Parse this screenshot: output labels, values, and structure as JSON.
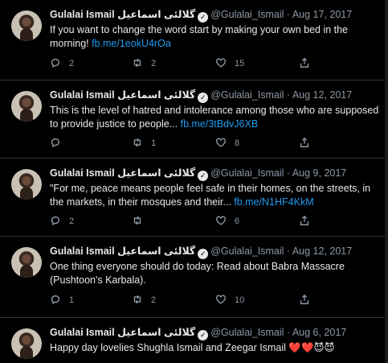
{
  "tweets": [
    {
      "name": "Gulalai Ismail گلالئی اسماعیل",
      "handle": "@Gulalai_Ismail",
      "date": "Aug 17, 2017",
      "text": "If you  want to change the word start by making your own bed in the morning! ",
      "link": "fb.me/1eokU4rOa",
      "replies": "2",
      "retweets": "2",
      "likes": "15"
    },
    {
      "name": "Gulalai Ismail گلالئی اسماعیل",
      "handle": "@Gulalai_Ismail",
      "date": "Aug 12, 2017",
      "text": "This is the level of hatred and intolerance among those who are supposed to provide justice to people... ",
      "link": "fb.me/3tBdvJ6XB",
      "replies": "",
      "retweets": "1",
      "likes": "8"
    },
    {
      "name": "Gulalai Ismail گلالئی اسماعیل",
      "handle": "@Gulalai_Ismail",
      "date": "Aug 9, 2017",
      "text": "\"For me, peace means people feel safe in their homes, on the streets, in the markets, in their mosques and their... ",
      "link": "fb.me/N1HF4KkM",
      "replies": "2",
      "retweets": "",
      "likes": "6"
    },
    {
      "name": "Gulalai Ismail گلالئی اسماعیل",
      "handle": "@Gulalai_Ismail",
      "date": "Aug 12, 2017",
      "text": "One thing everyone should do today: Read about Babra Massacre (Pushtoon's Karbala).",
      "link": "",
      "replies": "1",
      "retweets": "2",
      "likes": "10"
    },
    {
      "name": "Gulalai Ismail گلالئی اسماعیل",
      "handle": "@Gulalai_Ismail",
      "date": "Aug 6, 2017",
      "text": "Happy day lovelies Shughla Ismail and Zeegar Ismail ❤️❤️😈😈",
      "link": "",
      "replies": "",
      "retweets": "",
      "likes": ""
    }
  ],
  "icons": {
    "reply": "reply-icon",
    "retweet": "retweet-icon",
    "like": "heart-icon",
    "share": "share-icon",
    "verified": "verified-badge-icon"
  },
  "colors": {
    "background": "#000000",
    "link": "#1d9bf0",
    "muted": "#8b98a5",
    "divider": "#2f3336"
  }
}
